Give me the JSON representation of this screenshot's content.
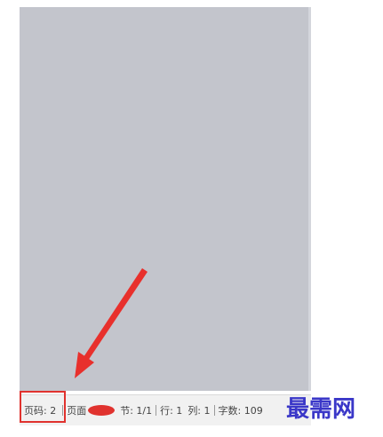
{
  "statusbar": {
    "page_number": "页码: 2",
    "page_label": "页面",
    "section": "节: 1/1",
    "row": "行: 1",
    "column": "列: 1",
    "word_count": "字数: 109"
  },
  "watermark": {
    "text": "最需网"
  },
  "colors": {
    "workspace": "#c3c5cc",
    "annotation_red": "#e0322e",
    "watermark_blue": "#3a37c8"
  }
}
